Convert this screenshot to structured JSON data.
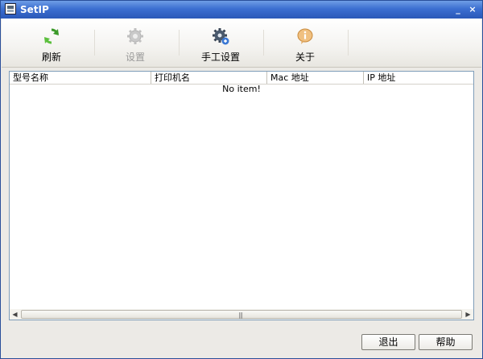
{
  "window": {
    "title": "SetIP"
  },
  "toolbar": {
    "items": [
      {
        "label": "刷新",
        "icon": "refresh-icon",
        "enabled": true
      },
      {
        "label": "设置",
        "icon": "settings-gear-icon",
        "enabled": false
      },
      {
        "label": "手工设置",
        "icon": "manual-settings-icon",
        "enabled": true
      },
      {
        "label": "关于",
        "icon": "info-icon",
        "enabled": true
      }
    ]
  },
  "list": {
    "columns": [
      "型号名称",
      "打印机名",
      "Mac 地址",
      "IP 地址"
    ],
    "empty_text": "No item!"
  },
  "buttons": {
    "exit": "退出",
    "help": "帮助"
  },
  "colors": {
    "titlebar": "#3c6fd1",
    "refresh": "#3c9a2a",
    "info": "#e0a860",
    "border": "#7f9db9"
  }
}
